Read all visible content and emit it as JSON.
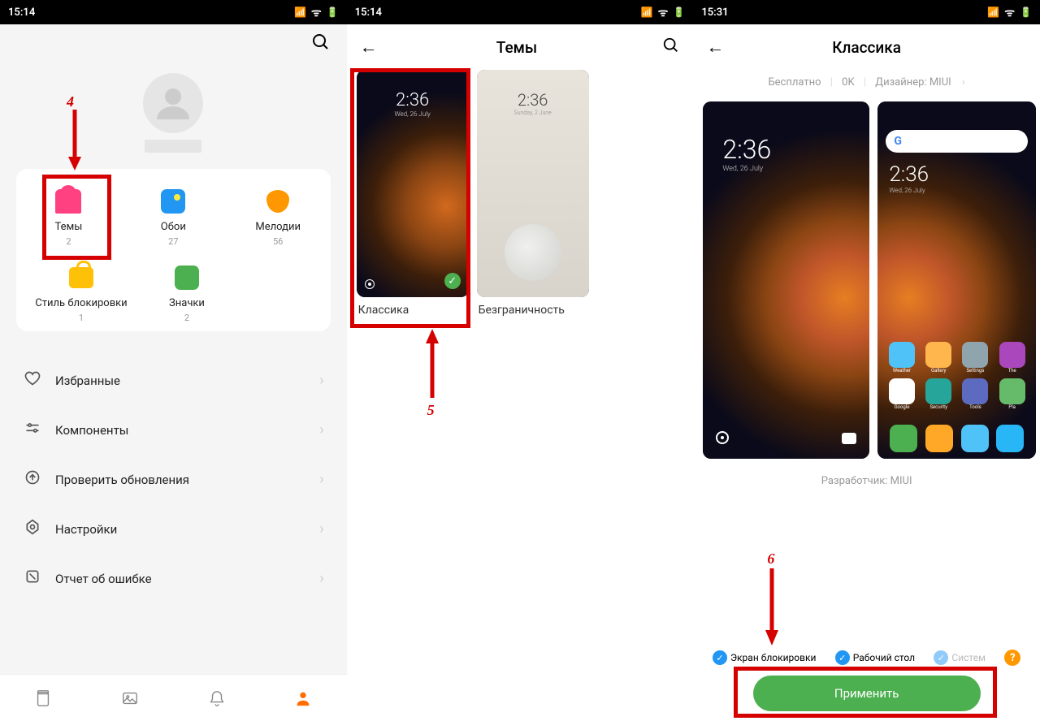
{
  "statusbar": {
    "time1": "15:14",
    "time2": "15:14",
    "time3": "15:31"
  },
  "screen1": {
    "grid": {
      "themes": {
        "label": "Темы",
        "count": "2"
      },
      "wallpaper": {
        "label": "Обои",
        "count": "27"
      },
      "ringtone": {
        "label": "Мелодии",
        "count": "56"
      },
      "lockstyle": {
        "label": "Стиль блокировки",
        "count": "1"
      },
      "icons": {
        "label": "Значки",
        "count": "2"
      }
    },
    "menu": {
      "favorites": "Избранные",
      "components": "Компоненты",
      "updates": "Проверить обновления",
      "settings": "Настройки",
      "report": "Отчет об ошибке"
    }
  },
  "screen2": {
    "title": "Темы",
    "themes": {
      "classic": {
        "name": "Классика",
        "time": "2:36",
        "date": "Wed, 26 July"
      },
      "unlimited": {
        "name": "Безграничность",
        "time": "2:36",
        "date": "Sunday, 2 June"
      }
    }
  },
  "screen3": {
    "title": "Классика",
    "meta": {
      "price": "Бесплатно",
      "size": "0K",
      "designer": "Дизайнер: MIUI"
    },
    "preview": {
      "time": "2:36",
      "date": "Wed, 26 July"
    },
    "home": {
      "time": "2:36",
      "date": "Wed, 26 July",
      "apps": {
        "weather": "Weather",
        "gallery": "Gallery",
        "settings": "Settings",
        "theme": "The",
        "google": "Google",
        "security": "Security",
        "tools": "Tools",
        "play": "Pla"
      }
    },
    "developer": "Разработчик: MIUI",
    "options": {
      "lock": "Экран блокировки",
      "desktop": "Рабочий стол",
      "system": "Систем"
    },
    "apply": "Применить"
  },
  "annotations": {
    "n4": "4",
    "n5": "5",
    "n6": "6"
  }
}
